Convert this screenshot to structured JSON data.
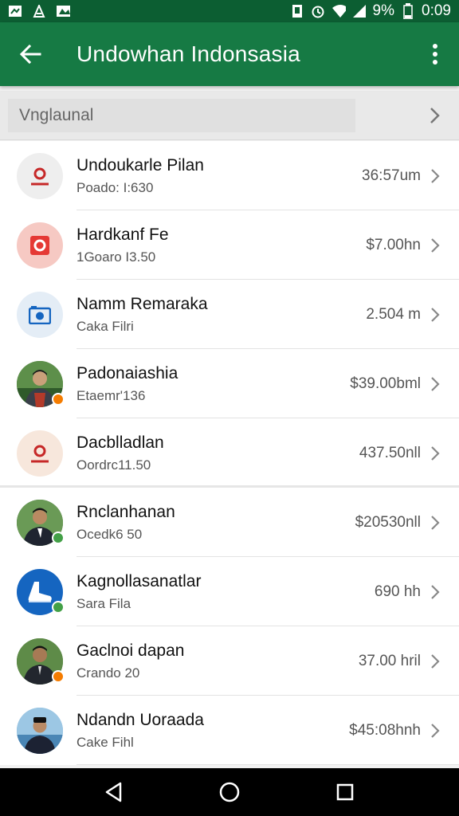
{
  "status_bar": {
    "battery": "9%",
    "time": "0:09",
    "icons": [
      "notification-icon",
      "notification-icon",
      "notification-icon",
      "alarm-icon",
      "wifi-icon",
      "signal-icon",
      "battery-icon"
    ]
  },
  "app_bar": {
    "title": "Undowhan Indonsasia",
    "back_icon": "arrow-back-icon",
    "menu_icon": "more-vert-icon"
  },
  "category": {
    "label": "Vnglaunal"
  },
  "items": [
    {
      "title": "Undoukarle Pilan",
      "subtitle": "Poado: I:630",
      "value": "36:57um",
      "icon": "profile-icon",
      "icon_color": "#c62828",
      "bg": "#eeeeee"
    },
    {
      "title": "Hardkanf Fe",
      "subtitle": "1Goaro I3.50",
      "value": "$7.00hn",
      "icon": "rounded-square-icon",
      "icon_color": "#e53935",
      "bg": "#f6c9c3"
    },
    {
      "title": "Namm Remaraka",
      "subtitle": "Caka Filri",
      "value": "2.504 m",
      "icon": "camera-icon",
      "icon_color": "#1565c0",
      "bg": "#e4edf6"
    },
    {
      "title": "Padonaiashia",
      "subtitle": "Etaemr'136",
      "value": "$39.00bml",
      "icon": "avatar-photo",
      "badge": "#f57c00"
    },
    {
      "title": "Dacblladlan",
      "subtitle": "Oordrc11.50",
      "value": "437.50nll",
      "icon": "profile-icon",
      "icon_color": "#c62828",
      "bg": "#f7e7dc"
    },
    {
      "title": "Rnclanhanan",
      "subtitle": "Ocedk6 50",
      "value": "$20530nll",
      "icon": "avatar-photo",
      "badge": "#43a047"
    },
    {
      "title": "Kagnollasanatlar",
      "subtitle": "Sara Fila",
      "value": "690 hh",
      "icon": "foot-icon",
      "icon_color": "#ffffff",
      "bg": "#1565c0",
      "badge": "#43a047"
    },
    {
      "title": "Gaclnoi dapan",
      "subtitle": "Crando 20",
      "value": "37.00 hril",
      "icon": "avatar-photo",
      "badge": "#f57c00"
    },
    {
      "title": "Ndandn Uoraada",
      "subtitle": "Cake Fihl",
      "value": "$45:08hnh",
      "icon": "avatar-photo"
    }
  ],
  "nav_bar": {
    "icons": [
      "back-triangle-icon",
      "home-circle-icon",
      "recents-square-icon"
    ]
  }
}
